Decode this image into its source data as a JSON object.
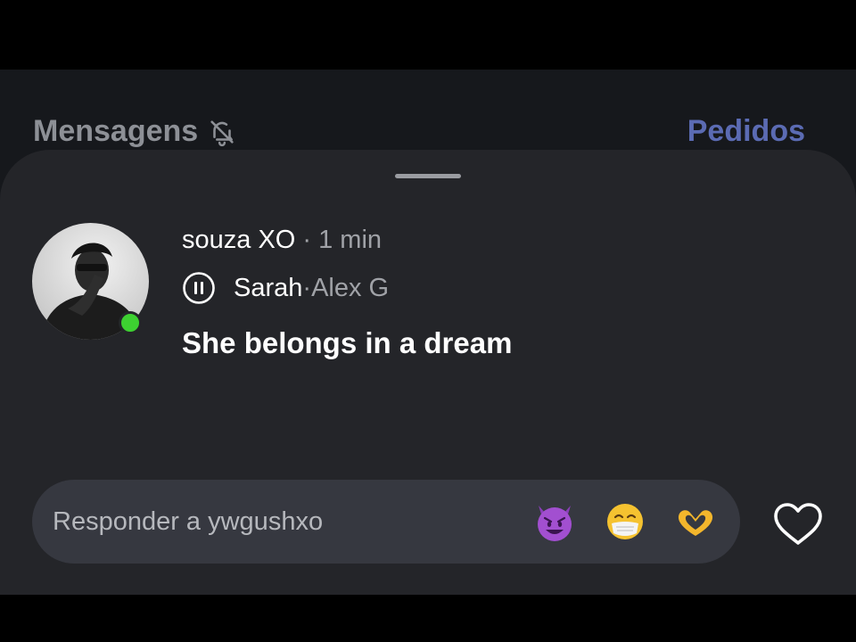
{
  "header": {
    "title": "Mensagens",
    "mute_icon": "bell-off-icon",
    "requests_label": "Pedidos"
  },
  "note": {
    "username": "souza XO",
    "time": "1 min",
    "separator": " · ",
    "music": {
      "state_icon": "pause-icon",
      "song": "Sarah",
      "artist": "Alex G"
    },
    "text": "She belongs in a dream",
    "online": true
  },
  "reply": {
    "placeholder": "Responder a ywgushxo",
    "quick_reactions": [
      "smiling-devil-emoji",
      "mask-face-emoji",
      "heart-hands-emoji"
    ],
    "like_icon": "heart-outline-icon"
  },
  "colors": {
    "background": "#16181c",
    "sheet": "#242529",
    "input": "#363840",
    "link": "#5b6bb3",
    "online": "#3dd131"
  }
}
